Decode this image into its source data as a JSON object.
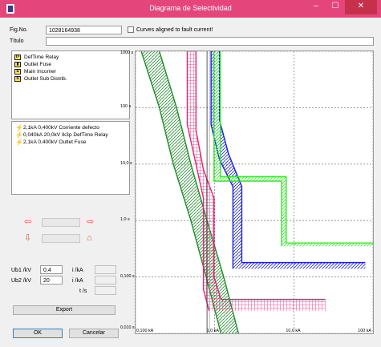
{
  "window": {
    "title": "Diagrama de Selectividad",
    "minimize_glyph": "–",
    "maximize_glyph": "☐",
    "close_glyph": "✕",
    "accent": "#e4467c"
  },
  "form": {
    "figno_label": "Fig.No.",
    "figno_value": "1028164938",
    "curves_aligned_label": "Curves aligned to fault current!",
    "titulo_label": "Título",
    "titulo_value": ""
  },
  "devices": [
    {
      "name": "DefTime Relay",
      "icon": "def-time-relay-icon",
      "glyph": "I>"
    },
    {
      "name": "Outlet Fuse",
      "icon": "fuse-icon",
      "glyph": "▮"
    },
    {
      "name": "Main Incomer",
      "icon": "breaker-icon",
      "glyph": "S"
    },
    {
      "name": "Outlet Sub Distrib.",
      "icon": "breaker-icon",
      "glyph": "S"
    }
  ],
  "fault_events": [
    {
      "text": "2,1kA 0,400kV Corriente defecto",
      "color": "#d8261c"
    },
    {
      "text": "0,040kA 20,0kV Ik3p DefTime Relay",
      "color": "#e24a5a"
    },
    {
      "text": "2,1kA 0,400kV Outlet Fuse",
      "color": "#d8261c"
    }
  ],
  "nav": {
    "left_glyph": "⇦",
    "right_glyph": "⇨",
    "down_glyph": "⇩",
    "home_glyph": "⌂"
  },
  "params": {
    "ub1_label": "Ub1 /kV",
    "ub1_value": "0,4",
    "ub2_label": "Ub2 /kV",
    "ub2_value": "20",
    "i_label_1": "i /kA",
    "i_label_2": "i /kA",
    "t_label": "t /s"
  },
  "buttons": {
    "export": "Export",
    "ok": "OK",
    "cancel": "Cancelar"
  },
  "chart_data": {
    "type": "line",
    "x_scale": "log",
    "y_scale": "log",
    "xlim": [
      0.1,
      100
    ],
    "ylim": [
      0.01,
      1000
    ],
    "x_ticks": [
      "0,100 kA",
      "1,0 kA",
      "10,0 kA",
      "100 kA"
    ],
    "y_ticks": [
      "1000 s",
      "100 s",
      "10,0 s",
      "1,0 s",
      "0,100 s",
      "0,010 s"
    ],
    "grid": true,
    "fault_current_kA": 0.8,
    "bands": [
      {
        "color": "#1f8c2a",
        "hatch": "diag",
        "left": [
          [
            0.118,
            1000
          ],
          [
            0.2,
            100
          ],
          [
            0.3,
            10
          ],
          [
            0.5,
            1
          ],
          [
            0.78,
            0.1
          ],
          [
            1.2,
            0.01
          ]
        ],
        "right": [
          [
            0.2,
            1000
          ],
          [
            0.33,
            100
          ],
          [
            0.5,
            10
          ],
          [
            0.8,
            1
          ],
          [
            1.3,
            0.1
          ],
          [
            2.0,
            0.01
          ]
        ]
      },
      {
        "color": "#e0267a",
        "hatch": "grid",
        "left": [
          [
            0.45,
            1000
          ],
          [
            0.45,
            50
          ],
          [
            0.58,
            10
          ],
          [
            0.72,
            2.5
          ],
          [
            0.72,
            0.06
          ],
          [
            0.85,
            0.025
          ]
        ],
        "right": [
          [
            0.58,
            1000
          ],
          [
            0.58,
            40
          ],
          [
            0.72,
            8
          ],
          [
            0.98,
            2.5
          ],
          [
            0.98,
            0.1
          ],
          [
            1.2,
            0.04
          ],
          [
            25,
            0.04
          ]
        ]
      },
      {
        "color": "#1a22d8",
        "hatch": "diag",
        "left": [
          [
            0.9,
            1000
          ],
          [
            0.9,
            50
          ],
          [
            1.15,
            12
          ],
          [
            1.7,
            4
          ],
          [
            1.7,
            0.14
          ]
        ],
        "right": [
          [
            1.15,
            1000
          ],
          [
            1.15,
            60
          ],
          [
            1.5,
            15
          ],
          [
            2.2,
            4
          ],
          [
            2.2,
            0.18
          ],
          [
            80,
            0.18
          ]
        ]
      },
      {
        "color": "#33e82a",
        "hatch": "diag",
        "left": [
          [
            0.98,
            1000
          ],
          [
            0.98,
            5
          ],
          [
            7,
            5
          ],
          [
            7,
            0.35
          ]
        ],
        "right": [
          [
            1.18,
            1000
          ],
          [
            1.18,
            6
          ],
          [
            8,
            6
          ],
          [
            8,
            0.4
          ],
          [
            100,
            0.4
          ]
        ]
      }
    ]
  }
}
